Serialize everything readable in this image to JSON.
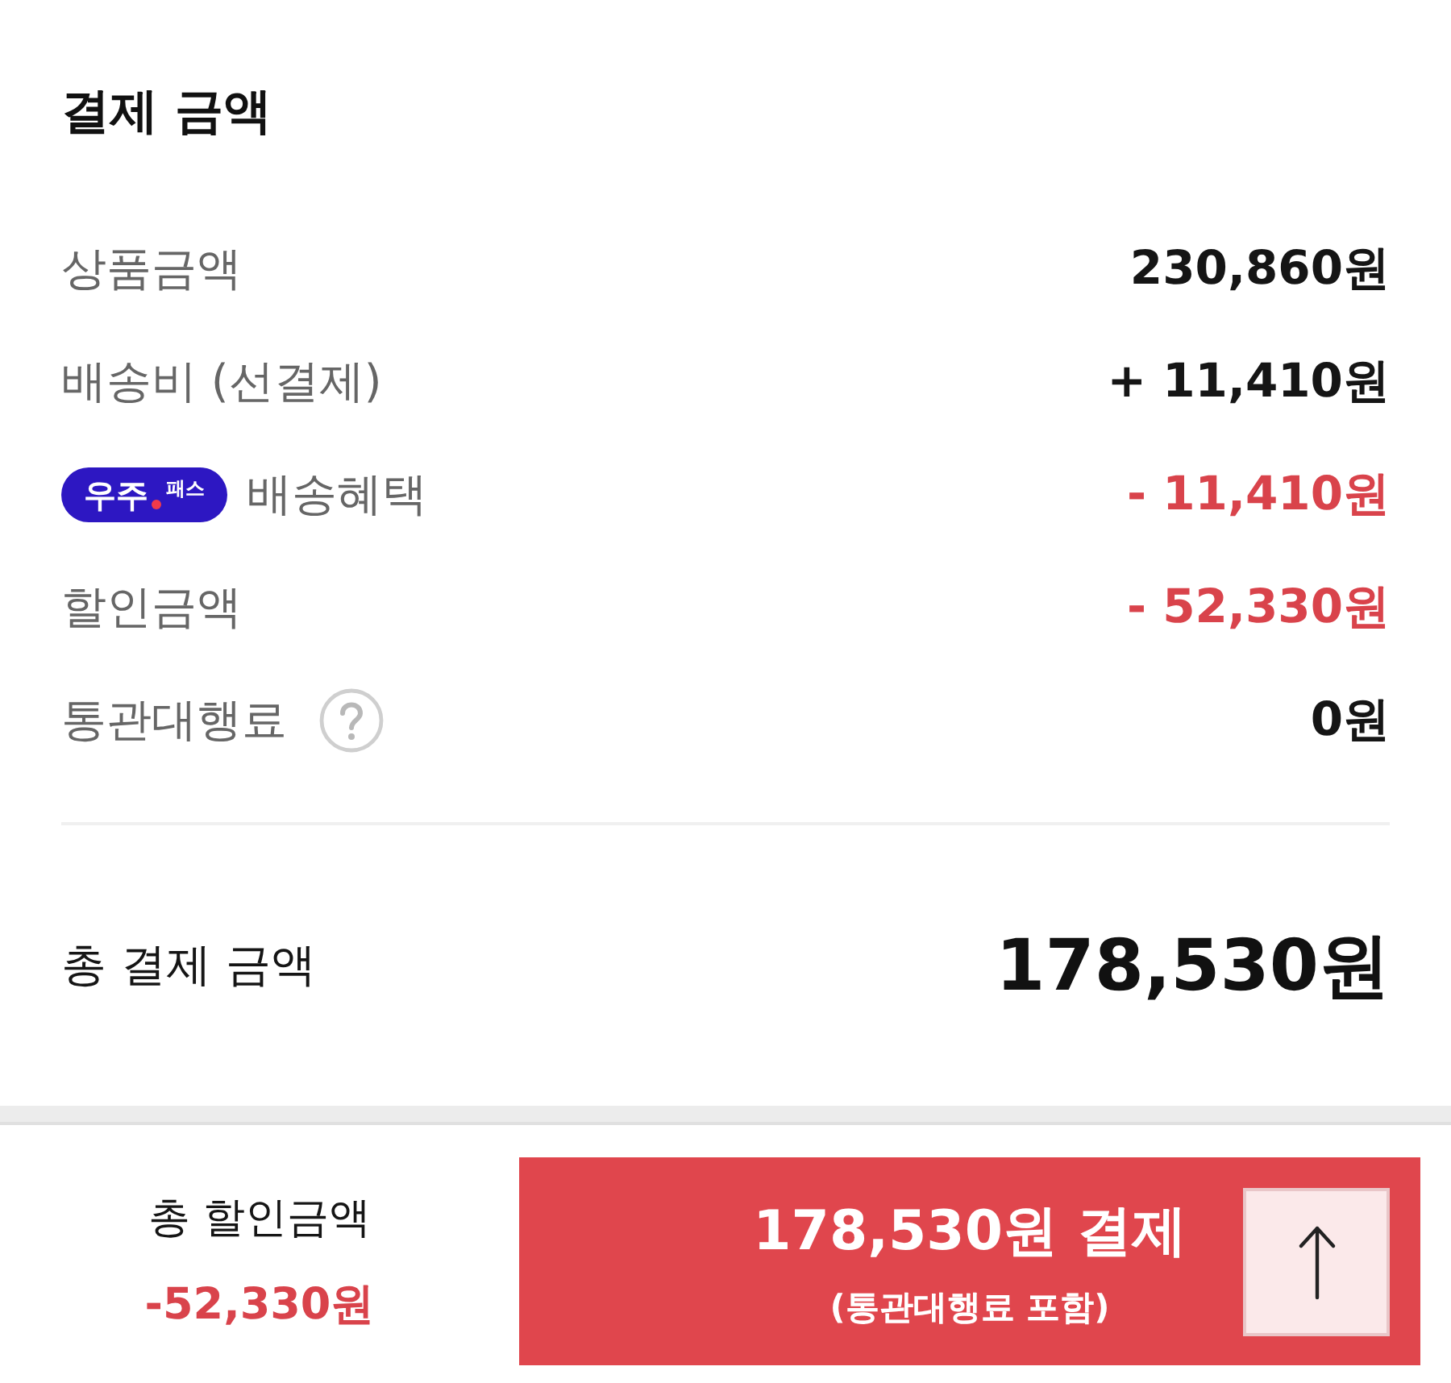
{
  "section": {
    "title": "결제 금액"
  },
  "rows": [
    {
      "label": "상품금액",
      "value": "230,860원",
      "negative": false,
      "help": false
    },
    {
      "label": "배송비 (선결제)",
      "value": "+ 11,410원",
      "negative": false,
      "help": false
    },
    {
      "label": "배송혜택",
      "badge": {
        "main": "우주",
        "sub": "패스"
      },
      "value": "- 11,410원",
      "negative": true,
      "help": false
    },
    {
      "label": "할인금액",
      "value": "- 52,330원",
      "negative": true,
      "help": false
    },
    {
      "label": "통관대행료",
      "value": "0원",
      "negative": false,
      "help": true
    }
  ],
  "total": {
    "label": "총 결제 금액",
    "value": "178,530원"
  },
  "bottom_bar": {
    "discount_label": "총 할인금액",
    "discount_value": "-52,330원",
    "pay_button": {
      "label": "178,530원 결제",
      "note": "(통관대행료 포함)"
    }
  }
}
